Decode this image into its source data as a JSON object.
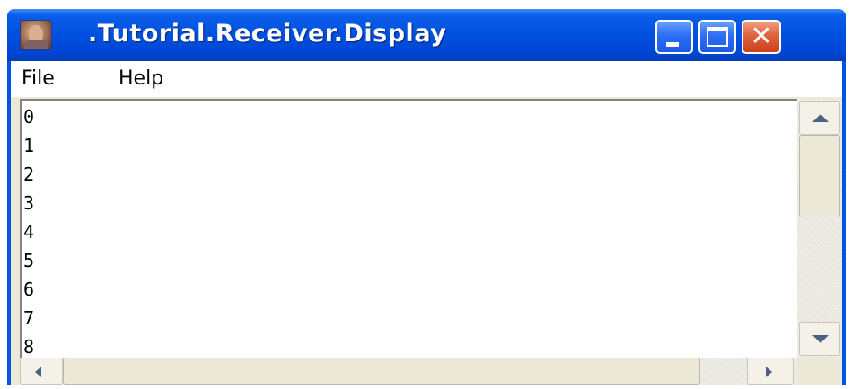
{
  "window": {
    "title": ".Tutorial.Receiver.Display",
    "icon": "app-portrait-icon",
    "controls": {
      "minimize_icon": "minimize-icon",
      "maximize_icon": "maximize-icon",
      "close_icon": "close-icon",
      "close_glyph": "✕"
    },
    "accent_color": "#0054e3",
    "close_color": "#e0643e"
  },
  "menu": {
    "items": [
      {
        "label": "File"
      },
      {
        "label": "Help"
      }
    ]
  },
  "text_area": {
    "lines": [
      "0",
      "1",
      "2",
      "3",
      "4",
      "5",
      "6",
      "7",
      "8"
    ]
  },
  "scrollbars": {
    "vertical": {
      "up_icon": "arrow-up-icon",
      "down_icon": "arrow-down-icon",
      "position": 0
    },
    "horizontal": {
      "left_icon": "arrow-left-icon",
      "right_icon": "arrow-right-icon",
      "position": 0
    }
  }
}
